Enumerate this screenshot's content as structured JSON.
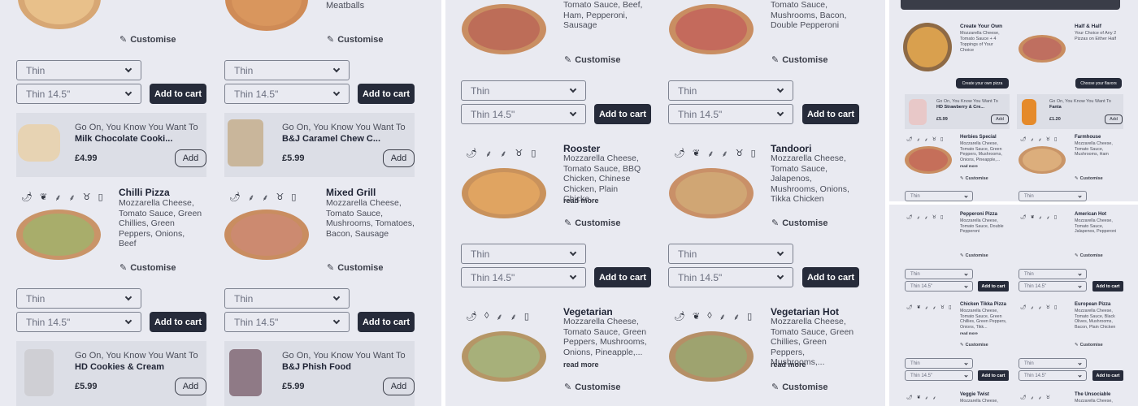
{
  "colors": {
    "panel_bg": "#e9eaf1",
    "dark_button": "#262b3a",
    "promo_bg": "#dcdee6",
    "crust": "#c9925c",
    "cheese": "#e3a865"
  },
  "common": {
    "customise": "Customise",
    "crust": "Thin",
    "size": "Thin 14.5\"",
    "add_to_cart": "Add to cart",
    "add": "Add",
    "read_more": "read more",
    "promo_line": "Go On, You Know You Want To"
  },
  "panel1": {
    "top_left_desc": "",
    "top_right_desc": "Meatballs",
    "promo1": {
      "name": "Milk Chocolate Cooki...",
      "price": "£4.99"
    },
    "promo2": {
      "name": "B&J Caramel Chew C...",
      "price": "£5.99"
    },
    "chilli": {
      "title": "Chilli Pizza",
      "desc": "Mozzarella Cheese, Tomato Sauce, Green Chillies, Green Peppers, Onions, Beef"
    },
    "grill": {
      "title": "Mixed Grill",
      "desc": "Mozzarella Cheese, Tomato Sauce, Mushrooms, Tomatoes, Bacon, Sausage"
    },
    "promo3": {
      "name": "HD Cookies & Cream",
      "price": "£5.99"
    },
    "promo4": {
      "name": "B&J Phish Food",
      "price": "£5.99"
    }
  },
  "panel2": {
    "top_left_desc": "Tomato Sauce, Beef, Ham, Pepperoni, Sausage",
    "top_right_desc": "Tomato Sauce, Mushrooms, Bacon, Double Pepperoni",
    "rooster": {
      "title": "Rooster",
      "desc": "Mozzarella Cheese, Tomato Sauce, BBQ Chicken, Chinese Chicken, Plain Chicke..."
    },
    "tandoori": {
      "title": "Tandoori",
      "desc": "Mozzarella Cheese, Tomato Sauce, Jalapenos, Mushrooms, Onions, Tikka Chicken"
    },
    "vegetarian": {
      "title": "Vegetarian",
      "desc": "Mozzarella Cheese, Tomato Sauce, Green Peppers, Mushrooms, Onions, Pineapple,..."
    },
    "vegetarian_hot": {
      "title": "Vegetarian Hot",
      "desc": "Mozzarella Cheese, Tomato Sauce, Green Chillies, Green Peppers, Mushrooms,..."
    }
  },
  "panel3": {
    "create": {
      "title": "Create Your Own",
      "desc": "Mozzarella Cheese, Tomato Sauce + 4 Toppings of Your Choice",
      "button": "Create your own pizza"
    },
    "half": {
      "title": "Half & Half",
      "desc": "Your Choice of Any 2 Pizzas on Either Half",
      "button": "Choose your flavors"
    },
    "promo1": {
      "name": "HD Strawberry & Cre...",
      "price": "£5.99"
    },
    "promo2": {
      "name": "Fanta",
      "price": "£1.20"
    },
    "herbies": {
      "title": "Herbies Special",
      "desc": "Mozzarella Cheese, Tomato Sauce, Green Peppers, Mushrooms, Onions, Pineapple,..."
    },
    "farmhouse": {
      "title": "Farmhouse",
      "desc": "Mozzarella Cheese, Tomato Sauce, Mushrooms, Ham"
    }
  },
  "panel4": {
    "pepperoni": {
      "title": "Pepperoni Pizza",
      "desc": "Mozzarella Cheese, Tomato Sauce, Double Pepperoni"
    },
    "american": {
      "title": "American Hot",
      "desc": "Mozzarella Cheese, Tomato Sauce, Jalapenos, Pepperoni"
    },
    "tikka": {
      "title": "Chicken Tikka Pizza",
      "desc": "Mozzarella Cheese, Tomato Sauce, Green Chillies, Green Peppers, Onions, Tikk..."
    },
    "european": {
      "title": "European Pizza",
      "desc": "Mozzarella Cheese, Tomato Sauce, Black Olives, Mushrooms, Bacon, Plain Chicken"
    },
    "veggie": {
      "title": "Veggie Twist",
      "desc": "Mozzarella Cheese,"
    },
    "sociable": {
      "title": "The Unsociable",
      "desc": "Mozzarella Cheese,"
    }
  }
}
